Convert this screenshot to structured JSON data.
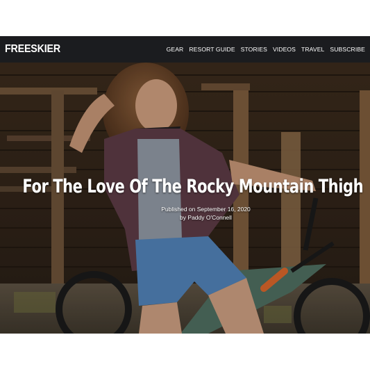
{
  "site": {
    "logo": "FREESKIER"
  },
  "nav": {
    "items": [
      {
        "label": "GEAR"
      },
      {
        "label": "RESORT GUIDE"
      },
      {
        "label": "STORIES"
      },
      {
        "label": "VIDEOS"
      },
      {
        "label": "TRAVEL"
      },
      {
        "label": "SUBSCRIBE"
      }
    ]
  },
  "article": {
    "title": "For The Love Of The Rocky Mountain Thigh",
    "published_prefix": "Published on",
    "published_date": "September 16, 2020",
    "by_prefix": "by",
    "author": "Paddy O'Connell"
  },
  "colors": {
    "navbar_bg": "#1b1c1f",
    "nav_text": "#ffffff",
    "page_bg": "#ffffff"
  }
}
